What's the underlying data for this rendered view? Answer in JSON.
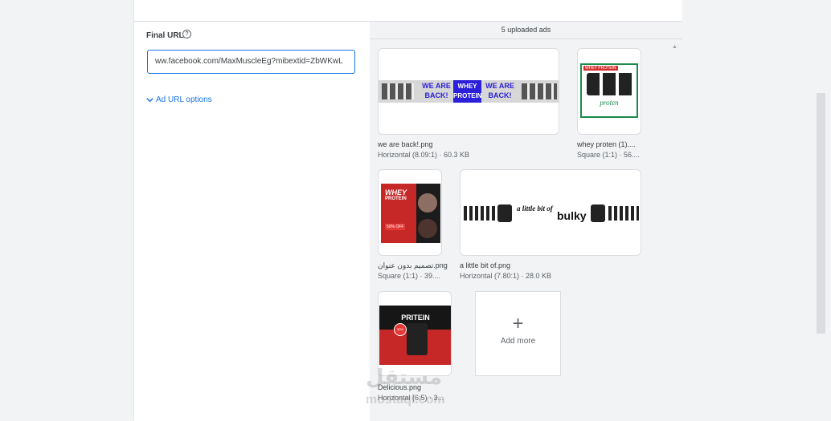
{
  "form": {
    "final_url_label": "Final URL",
    "help_icon": "?",
    "final_url_value": "ww.facebook.com/MaxMuscleEg?mibextid=ZbWKwL",
    "url_options_label": "Ad URL options"
  },
  "uploads": {
    "count_label": "5 uploaded ads",
    "items": [
      {
        "filename": "we are back!.png",
        "meta": "Horizontal (8.09:1) · 60.3 KB",
        "banner_texts": [
          "WE ARE BACK!",
          "WHEY PROTEIN",
          "WE ARE BACK!"
        ]
      },
      {
        "filename": "whey proten (1)....",
        "meta": "Square (1:1) · 56....",
        "tag": "WHEY PROTEIN",
        "sub": "proten"
      },
      {
        "filename": "تصميم بدون عنوان.png",
        "meta": "Square (1:1) · 39....",
        "title": "WHEY",
        "title2": "PROTEIN",
        "offer": "50% OFF"
      },
      {
        "filename": "a little bit of.png",
        "meta": "Horizontal (7.80:1) · 28.0 KB",
        "text1": "a little bit of",
        "text2": "bulky"
      },
      {
        "filename": "Delicious.png",
        "meta": "Horizontal (6:5) · 3...",
        "title": "PRITEIN",
        "badge": "30%"
      }
    ],
    "add_more_label": "Add more"
  },
  "watermark": {
    "arabic": "مستقل",
    "latin": "mostaql.com"
  },
  "colors": {
    "accent": "#1a73e8",
    "banner_blue": "#2b1fd9",
    "red": "#d32f2f",
    "green": "#1b8a4b"
  }
}
